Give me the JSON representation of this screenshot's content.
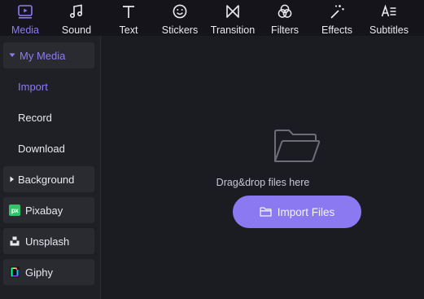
{
  "toolbar": {
    "tabs": [
      {
        "label": "Media",
        "icon": "media-icon",
        "active": true
      },
      {
        "label": "Sound",
        "icon": "music-note-icon"
      },
      {
        "label": "Text",
        "icon": "text-icon"
      },
      {
        "label": "Stickers",
        "icon": "smiley-icon"
      },
      {
        "label": "Transition",
        "icon": "bowtie-icon"
      },
      {
        "label": "Filters",
        "icon": "circles-icon"
      },
      {
        "label": "Effects",
        "icon": "magic-wand-icon"
      },
      {
        "label": "Subtitles",
        "icon": "subtitles-icon"
      }
    ]
  },
  "sidebar": {
    "my_media": "My Media",
    "import": "Import",
    "record": "Record",
    "download": "Download",
    "background": "Background",
    "pixabay": "Pixabay",
    "pixabay_logo": "px",
    "unsplash": "Unsplash",
    "giphy": "Giphy"
  },
  "main": {
    "drop_text": "Drag&drop files here",
    "import_button": "Import Files"
  },
  "colors": {
    "accent": "#8d7cf0",
    "button": "#8a79f0",
    "toolbar_bg": "#14141a",
    "sidebar_bg": "#1f1f26",
    "main_bg": "#1b1b22"
  }
}
